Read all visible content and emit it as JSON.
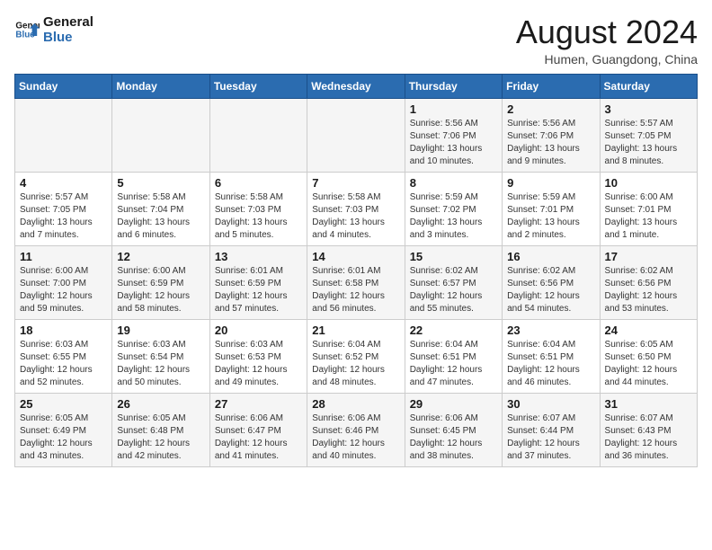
{
  "logo": {
    "line1": "General",
    "line2": "Blue"
  },
  "title": "August 2024",
  "location": "Humen, Guangdong, China",
  "days_of_week": [
    "Sunday",
    "Monday",
    "Tuesday",
    "Wednesday",
    "Thursday",
    "Friday",
    "Saturday"
  ],
  "weeks": [
    [
      {
        "day": "",
        "info": ""
      },
      {
        "day": "",
        "info": ""
      },
      {
        "day": "",
        "info": ""
      },
      {
        "day": "",
        "info": ""
      },
      {
        "day": "1",
        "info": "Sunrise: 5:56 AM\nSunset: 7:06 PM\nDaylight: 13 hours\nand 10 minutes."
      },
      {
        "day": "2",
        "info": "Sunrise: 5:56 AM\nSunset: 7:06 PM\nDaylight: 13 hours\nand 9 minutes."
      },
      {
        "day": "3",
        "info": "Sunrise: 5:57 AM\nSunset: 7:05 PM\nDaylight: 13 hours\nand 8 minutes."
      }
    ],
    [
      {
        "day": "4",
        "info": "Sunrise: 5:57 AM\nSunset: 7:05 PM\nDaylight: 13 hours\nand 7 minutes."
      },
      {
        "day": "5",
        "info": "Sunrise: 5:58 AM\nSunset: 7:04 PM\nDaylight: 13 hours\nand 6 minutes."
      },
      {
        "day": "6",
        "info": "Sunrise: 5:58 AM\nSunset: 7:03 PM\nDaylight: 13 hours\nand 5 minutes."
      },
      {
        "day": "7",
        "info": "Sunrise: 5:58 AM\nSunset: 7:03 PM\nDaylight: 13 hours\nand 4 minutes."
      },
      {
        "day": "8",
        "info": "Sunrise: 5:59 AM\nSunset: 7:02 PM\nDaylight: 13 hours\nand 3 minutes."
      },
      {
        "day": "9",
        "info": "Sunrise: 5:59 AM\nSunset: 7:01 PM\nDaylight: 13 hours\nand 2 minutes."
      },
      {
        "day": "10",
        "info": "Sunrise: 6:00 AM\nSunset: 7:01 PM\nDaylight: 13 hours\nand 1 minute."
      }
    ],
    [
      {
        "day": "11",
        "info": "Sunrise: 6:00 AM\nSunset: 7:00 PM\nDaylight: 12 hours\nand 59 minutes."
      },
      {
        "day": "12",
        "info": "Sunrise: 6:00 AM\nSunset: 6:59 PM\nDaylight: 12 hours\nand 58 minutes."
      },
      {
        "day": "13",
        "info": "Sunrise: 6:01 AM\nSunset: 6:59 PM\nDaylight: 12 hours\nand 57 minutes."
      },
      {
        "day": "14",
        "info": "Sunrise: 6:01 AM\nSunset: 6:58 PM\nDaylight: 12 hours\nand 56 minutes."
      },
      {
        "day": "15",
        "info": "Sunrise: 6:02 AM\nSunset: 6:57 PM\nDaylight: 12 hours\nand 55 minutes."
      },
      {
        "day": "16",
        "info": "Sunrise: 6:02 AM\nSunset: 6:56 PM\nDaylight: 12 hours\nand 54 minutes."
      },
      {
        "day": "17",
        "info": "Sunrise: 6:02 AM\nSunset: 6:56 PM\nDaylight: 12 hours\nand 53 minutes."
      }
    ],
    [
      {
        "day": "18",
        "info": "Sunrise: 6:03 AM\nSunset: 6:55 PM\nDaylight: 12 hours\nand 52 minutes."
      },
      {
        "day": "19",
        "info": "Sunrise: 6:03 AM\nSunset: 6:54 PM\nDaylight: 12 hours\nand 50 minutes."
      },
      {
        "day": "20",
        "info": "Sunrise: 6:03 AM\nSunset: 6:53 PM\nDaylight: 12 hours\nand 49 minutes."
      },
      {
        "day": "21",
        "info": "Sunrise: 6:04 AM\nSunset: 6:52 PM\nDaylight: 12 hours\nand 48 minutes."
      },
      {
        "day": "22",
        "info": "Sunrise: 6:04 AM\nSunset: 6:51 PM\nDaylight: 12 hours\nand 47 minutes."
      },
      {
        "day": "23",
        "info": "Sunrise: 6:04 AM\nSunset: 6:51 PM\nDaylight: 12 hours\nand 46 minutes."
      },
      {
        "day": "24",
        "info": "Sunrise: 6:05 AM\nSunset: 6:50 PM\nDaylight: 12 hours\nand 44 minutes."
      }
    ],
    [
      {
        "day": "25",
        "info": "Sunrise: 6:05 AM\nSunset: 6:49 PM\nDaylight: 12 hours\nand 43 minutes."
      },
      {
        "day": "26",
        "info": "Sunrise: 6:05 AM\nSunset: 6:48 PM\nDaylight: 12 hours\nand 42 minutes."
      },
      {
        "day": "27",
        "info": "Sunrise: 6:06 AM\nSunset: 6:47 PM\nDaylight: 12 hours\nand 41 minutes."
      },
      {
        "day": "28",
        "info": "Sunrise: 6:06 AM\nSunset: 6:46 PM\nDaylight: 12 hours\nand 40 minutes."
      },
      {
        "day": "29",
        "info": "Sunrise: 6:06 AM\nSunset: 6:45 PM\nDaylight: 12 hours\nand 38 minutes."
      },
      {
        "day": "30",
        "info": "Sunrise: 6:07 AM\nSunset: 6:44 PM\nDaylight: 12 hours\nand 37 minutes."
      },
      {
        "day": "31",
        "info": "Sunrise: 6:07 AM\nSunset: 6:43 PM\nDaylight: 12 hours\nand 36 minutes."
      }
    ]
  ]
}
